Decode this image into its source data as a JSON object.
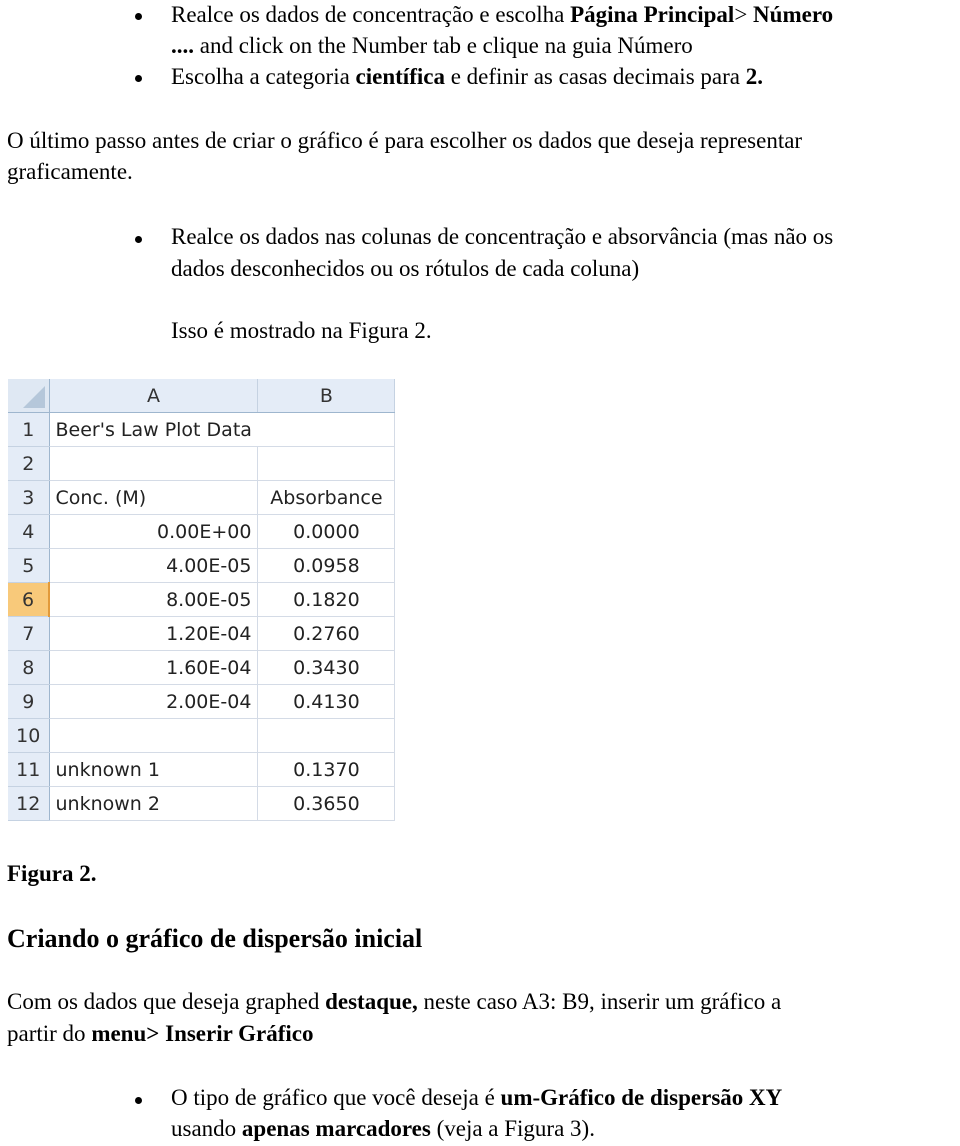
{
  "top_bullets": [
    {
      "line1": {
        "text": "Realce os dados de concentração e escolha ",
        "bold": "Página Principal",
        "text2": "> ",
        "bold2": "Número"
      },
      "line2": {
        "bold": "....",
        "text": " and click on the Number tab e clique na guia Número"
      }
    },
    {
      "line1": {
        "text": "Escolha a categoria ",
        "bold": "científica",
        "text2": " e definir as casas decimais para ",
        "bold2": "2."
      }
    }
  ],
  "paragraph1": {
    "line1": "O último passo antes de criar o gráfico é para escolher os dados que deseja representar",
    "line2": "graficamente."
  },
  "bullet2": {
    "line1": "Realce os dados nas colunas de concentração e absorvância (mas não os",
    "line2": "dados desconhecidos ou os rótulos de cada coluna)",
    "note": "Isso é mostrado na Figura 2."
  },
  "spreadsheet": {
    "columns": [
      "A",
      "B"
    ],
    "selected_row": "6",
    "rows": [
      {
        "num": "1",
        "a": "Beer's Law Plot Data",
        "b": ""
      },
      {
        "num": "2",
        "a": "",
        "b": ""
      },
      {
        "num": "3",
        "a": "Conc. (M)",
        "b": "Absorbance"
      },
      {
        "num": "4",
        "a": "0.00E+00",
        "b": "0.0000"
      },
      {
        "num": "5",
        "a": "4.00E-05",
        "b": "0.0958"
      },
      {
        "num": "6",
        "a": "8.00E-05",
        "b": "0.1820"
      },
      {
        "num": "7",
        "a": "1.20E-04",
        "b": "0.2760"
      },
      {
        "num": "8",
        "a": "1.60E-04",
        "b": "0.3430"
      },
      {
        "num": "9",
        "a": "2.00E-04",
        "b": "0.4130"
      },
      {
        "num": "10",
        "a": "",
        "b": ""
      },
      {
        "num": "11",
        "a": "unknown 1",
        "b": "0.1370"
      },
      {
        "num": "12",
        "a": "unknown 2",
        "b": "0.3650"
      }
    ]
  },
  "figure_caption": "Figura 2.",
  "section_heading": "Criando o gráfico de dispersão inicial",
  "paragraph2": {
    "l1_a": "Com os dados que deseja graphed ",
    "l1_b": "destaque,",
    "l1_c": " neste caso A3: B9, inserir um gráfico a",
    "l2_a": "partir do ",
    "l2_b": "menu> Inserir Gráfico"
  },
  "bullet3": {
    "l1_a": "O tipo de gráfico que você deseja é ",
    "l1_b": "um-Gráfico de dispersão XY",
    "l2_a": "usando ",
    "l2_b": "apenas marcadores",
    "l2_c": " (veja a Figura 3)."
  }
}
